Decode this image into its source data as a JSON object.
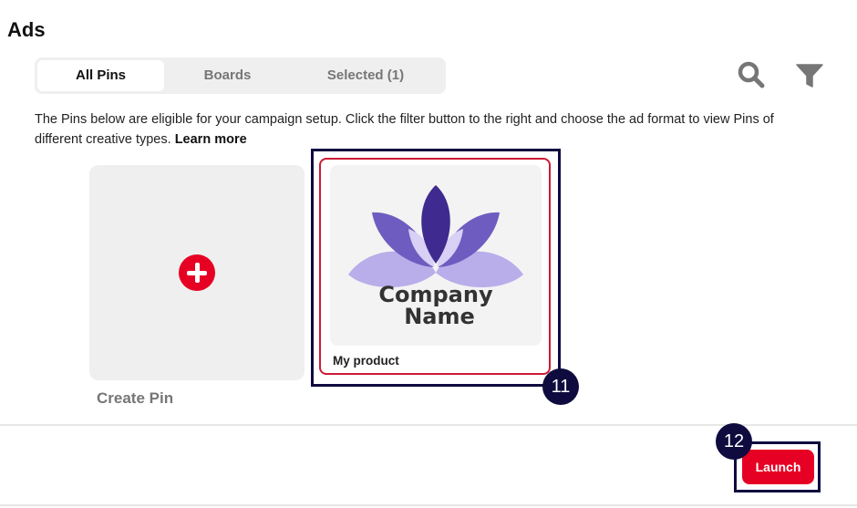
{
  "page": {
    "title": "Ads"
  },
  "tabs": [
    {
      "label": "All Pins",
      "active": true
    },
    {
      "label": "Boards",
      "active": false
    },
    {
      "label": "Selected (1)",
      "active": false
    }
  ],
  "toolbar": {
    "search_icon": "search-icon",
    "filter_icon": "filter-icon"
  },
  "description": {
    "text": "The Pins below are eligible for your campaign setup. Click the filter button to the right and choose the ad format to view Pins of different creative types.",
    "link": "Learn more"
  },
  "create_pin": {
    "label": "Create Pin",
    "icon": "plus-circle-icon"
  },
  "product": {
    "label": "My product",
    "logo_line1": "Company",
    "logo_line2": "Name"
  },
  "annotations": {
    "badge_11": "11",
    "badge_12": "12"
  },
  "footer": {
    "launch_label": "Launch"
  },
  "colors": {
    "accent": "#e60023",
    "annotation": "#0f0b3e",
    "tab_bg": "#efefef",
    "lotus_dark": "#3f2a8f",
    "lotus_mid": "#6f5cc0",
    "lotus_light": "#b9adea"
  }
}
